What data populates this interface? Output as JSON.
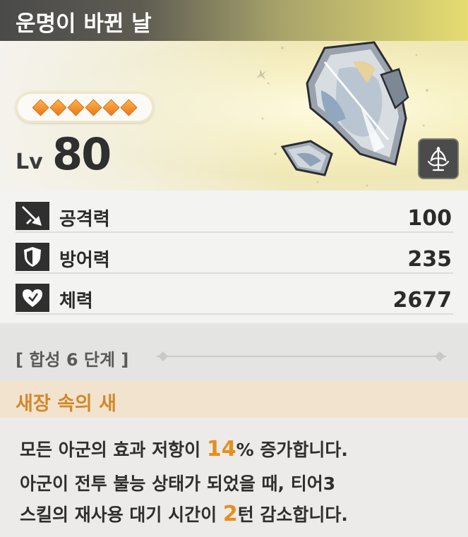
{
  "header": {
    "title": "운명이 바뀐 날"
  },
  "hero": {
    "stars": 6,
    "level_label": "Lv",
    "level_value": "80",
    "class_icon": "angel-wing-class-icon"
  },
  "stats": [
    {
      "icon": "sword-icon",
      "label": "공격력",
      "value": "100"
    },
    {
      "icon": "shield-icon",
      "label": "방어력",
      "value": "235"
    },
    {
      "icon": "heart-icon",
      "label": "체력",
      "value": "2677"
    }
  ],
  "synthesis": {
    "label": "[ 합성 6 단계 ]"
  },
  "skill": {
    "name": "새장 속의 새",
    "line1_pre": "모든 아군의 효과 저항이 ",
    "line1_num": "14",
    "line1_post": "% 증가합니다.",
    "line2": "아군이 전투 불능 상태가 되었을 때, 티어3",
    "line3_pre": "스킬의 재사용 대기 시간이 ",
    "line3_num": "2",
    "line3_post": "턴 감소합니다."
  },
  "colors": {
    "accent_orange": "#e5901c",
    "skill_title": "#d0892b",
    "header_gold": "#e6dc72"
  }
}
